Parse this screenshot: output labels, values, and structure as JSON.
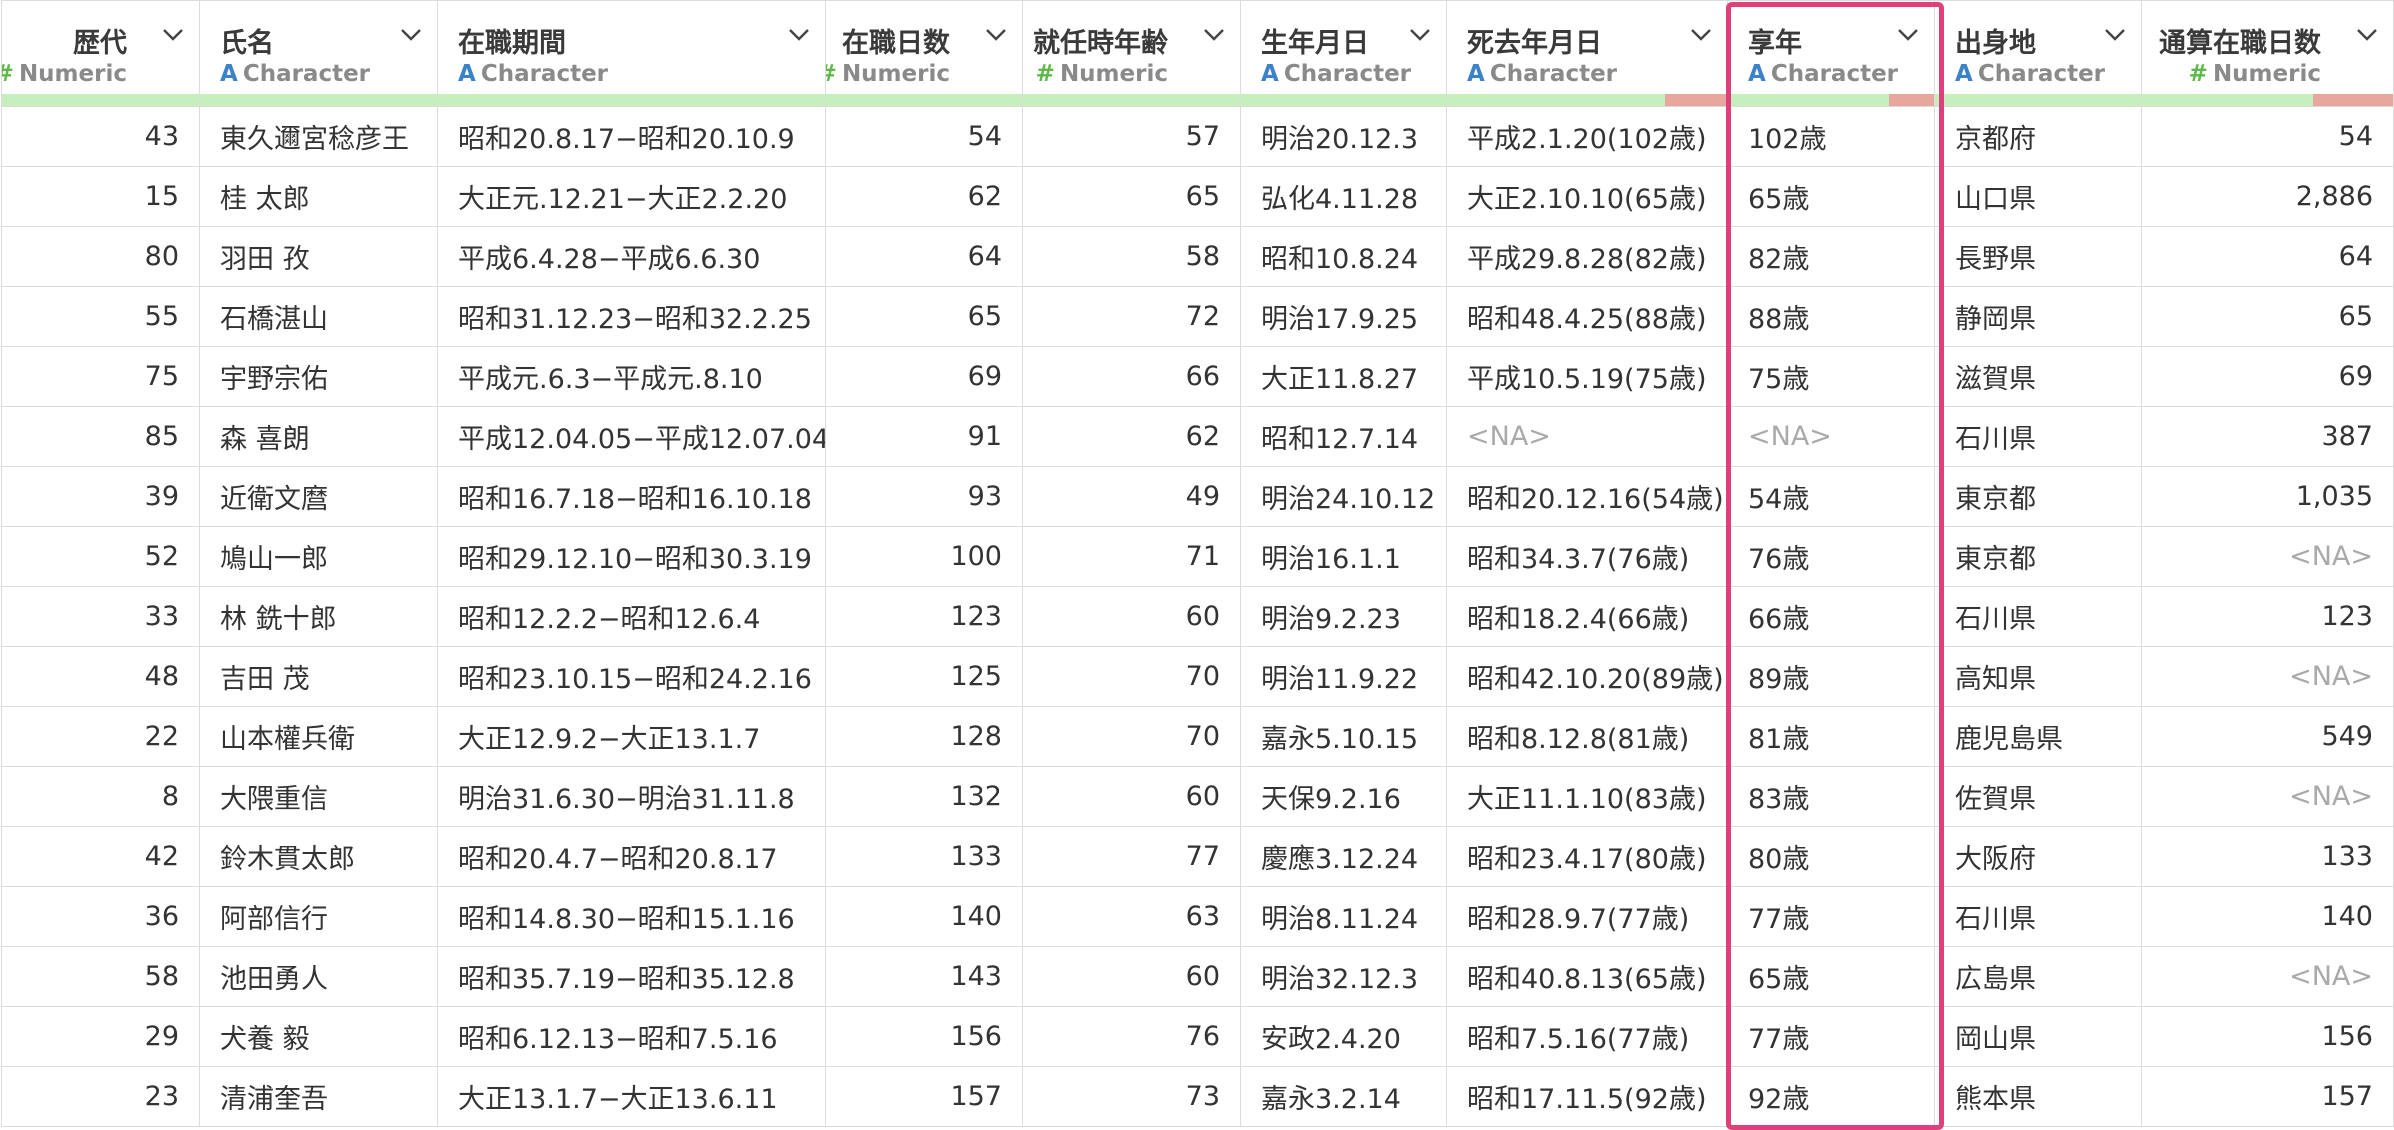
{
  "columns": [
    {
      "name": "歴代",
      "type": "Numeric",
      "na_frac": 0
    },
    {
      "name": "氏名",
      "type": "Character",
      "na_frac": 0
    },
    {
      "name": "在職期間",
      "type": "Character",
      "na_frac": 0
    },
    {
      "name": "在職日数",
      "type": "Numeric",
      "na_frac": 0
    },
    {
      "name": "就任時年齢",
      "type": "Numeric",
      "na_frac": 0
    },
    {
      "name": "生年月日",
      "type": "Character",
      "na_frac": 0
    },
    {
      "name": "死去年月日",
      "type": "Character",
      "na_frac": 0.22
    },
    {
      "name": "享年",
      "type": "Character",
      "na_frac": 0.22
    },
    {
      "name": "出身地",
      "type": "Character",
      "na_frac": 0
    },
    {
      "name": "通算在職日数",
      "type": "Numeric",
      "na_frac": 0.32
    }
  ],
  "rows": [
    [
      "43",
      "東久邇宮稔彦王",
      "昭和20.8.17−昭和20.10.9",
      "54",
      "57",
      "明治20.12.3",
      "平成2.1.20(102歳)",
      "102歳",
      "京都府",
      "54"
    ],
    [
      "15",
      "桂 太郎",
      "大正元.12.21−大正2.2.20",
      "62",
      "65",
      "弘化4.11.28",
      "大正2.10.10(65歳)",
      "65歳",
      "山口県",
      "2,886"
    ],
    [
      "80",
      "羽田 孜",
      "平成6.4.28−平成6.6.30",
      "64",
      "58",
      "昭和10.8.24",
      "平成29.8.28(82歳)",
      "82歳",
      "長野県",
      "64"
    ],
    [
      "55",
      "石橋湛山",
      "昭和31.12.23−昭和32.2.25",
      "65",
      "72",
      "明治17.9.25",
      "昭和48.4.25(88歳)",
      "88歳",
      "静岡県",
      "65"
    ],
    [
      "75",
      "宇野宗佑",
      "平成元.6.3−平成元.8.10",
      "69",
      "66",
      "大正11.8.27",
      "平成10.5.19(75歳)",
      "75歳",
      "滋賀県",
      "69"
    ],
    [
      "85",
      "森 喜朗",
      "平成12.04.05−平成12.07.04",
      "91",
      "62",
      "昭和12.7.14",
      "<NA>",
      "<NA>",
      "石川県",
      "387"
    ],
    [
      "39",
      "近衛文麿",
      "昭和16.7.18−昭和16.10.18",
      "93",
      "49",
      "明治24.10.12",
      "昭和20.12.16(54歳)",
      "54歳",
      "東京都",
      "1,035"
    ],
    [
      "52",
      "鳩山一郎",
      "昭和29.12.10−昭和30.3.19",
      "100",
      "71",
      "明治16.1.1",
      "昭和34.3.7(76歳)",
      "76歳",
      "東京都",
      "<NA>"
    ],
    [
      "33",
      "林 銑十郎",
      "昭和12.2.2−昭和12.6.4",
      "123",
      "60",
      "明治9.2.23",
      "昭和18.2.4(66歳)",
      "66歳",
      "石川県",
      "123"
    ],
    [
      "48",
      "吉田 茂",
      "昭和23.10.15−昭和24.2.16",
      "125",
      "70",
      "明治11.9.22",
      "昭和42.10.20(89歳)",
      "89歳",
      "高知県",
      "<NA>"
    ],
    [
      "22",
      "山本權兵衛",
      "大正12.9.2−大正13.1.7",
      "128",
      "70",
      "嘉永5.10.15",
      "昭和8.12.8(81歳)",
      "81歳",
      "鹿児島県",
      "549"
    ],
    [
      "8",
      "大隈重信",
      "明治31.6.30−明治31.11.8",
      "132",
      "60",
      "天保9.2.16",
      "大正11.1.10(83歳)",
      "83歳",
      "佐賀県",
      "<NA>"
    ],
    [
      "42",
      "鈴木貫太郎",
      "昭和20.4.7−昭和20.8.17",
      "133",
      "77",
      "慶應3.12.24",
      "昭和23.4.17(80歳)",
      "80歳",
      "大阪府",
      "133"
    ],
    [
      "36",
      "阿部信行",
      "昭和14.8.30−昭和15.1.16",
      "140",
      "63",
      "明治8.11.24",
      "昭和28.9.7(77歳)",
      "77歳",
      "石川県",
      "140"
    ],
    [
      "58",
      "池田勇人",
      "昭和35.7.19−昭和35.12.8",
      "143",
      "60",
      "明治32.12.3",
      "昭和40.8.13(65歳)",
      "65歳",
      "広島県",
      "<NA>"
    ],
    [
      "29",
      "犬養 毅",
      "昭和6.12.13−昭和7.5.16",
      "156",
      "76",
      "安政2.4.20",
      "昭和7.5.16(77歳)",
      "77歳",
      "岡山県",
      "156"
    ],
    [
      "23",
      "清浦奎吾",
      "大正13.1.7−大正13.6.11",
      "157",
      "73",
      "嘉永3.2.14",
      "昭和17.11.5(92歳)",
      "92歳",
      "熊本県",
      "157"
    ]
  ],
  "highlight_column": "享年",
  "colors": {
    "numeric_type": "#5fb84a",
    "character_type": "#3b82c9",
    "valid_bar": "#c5efbd",
    "na_bar": "#e8a79c",
    "highlight": "#e0407a"
  },
  "icons": {
    "numeric": "#",
    "character": "A",
    "column_menu": "chevron-down-icon"
  }
}
